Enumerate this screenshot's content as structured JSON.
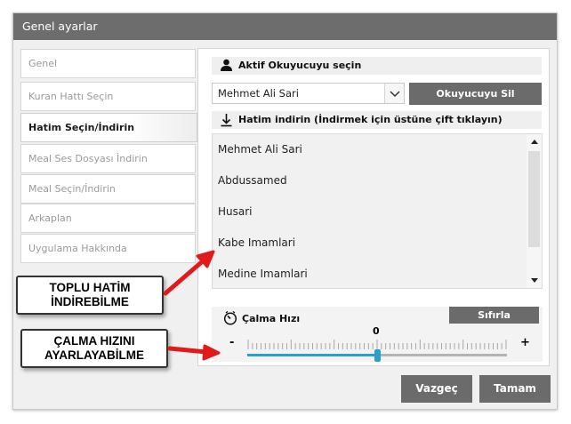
{
  "window": {
    "title": "Genel ayarlar"
  },
  "sidebar": {
    "items": [
      {
        "label": "Genel"
      },
      {
        "label": "Kuran Hattı Seçin"
      },
      {
        "label": "Hatim Seçin/İndirin"
      },
      {
        "label": "Meal Ses Dosyası İndirin"
      },
      {
        "label": "Meal Seçin/İndirin"
      },
      {
        "label": "Arkaplan"
      },
      {
        "label": "Uygulama Hakkında"
      }
    ],
    "active_index": 2
  },
  "reader_section": {
    "title": "Aktif Okuyucuyu seçin",
    "icon": "person-icon",
    "selected_reader": "Mehmet Ali Sari",
    "delete_button": "Okuyucuyu Sil"
  },
  "download_section": {
    "title": "Hatim indirin (İndirmek için üstüne çift tıklayın)",
    "icon": "download-icon",
    "items": [
      "Mehmet Ali Sari",
      "Abdussamed",
      "Husari",
      "Kabe Imamlari",
      "Medine Imamlari"
    ]
  },
  "speed_section": {
    "title": "Çalma Hızı",
    "icon": "speedometer-icon",
    "reset_button": "Sıfırla",
    "minus_label": "-",
    "plus_label": "+",
    "value_label": "0",
    "slider_position": 0.5
  },
  "footer": {
    "cancel_button": "Vazgeç",
    "ok_button": "Tamam"
  },
  "annotations": [
    {
      "text": "TOPLU HATİM İNDİREBİLME"
    },
    {
      "text": "ÇALMA HIZINI AYARLAYABİLME"
    }
  ],
  "colors": {
    "titlebar": "#6d6d6d",
    "button": "#6b6b6b",
    "slider_accent": "#2a9fd0",
    "arrow": "#e01b1b"
  }
}
